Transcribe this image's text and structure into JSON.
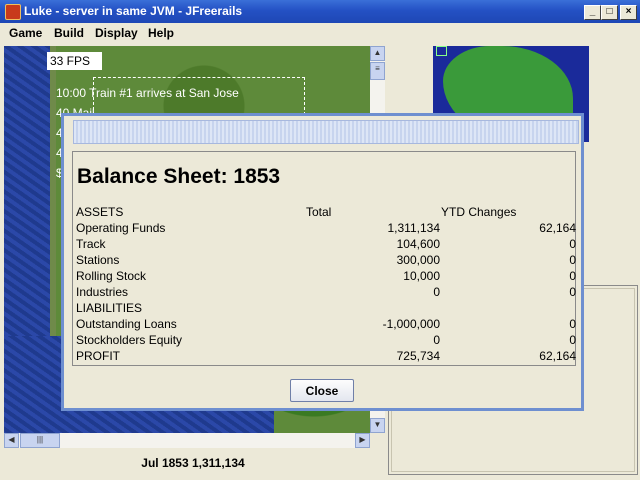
{
  "window": {
    "title": "Luke - server in same JVM - JFreerails"
  },
  "menu": {
    "items": [
      "Game",
      "Build",
      "Display",
      "Help"
    ]
  },
  "map": {
    "fps": "33 FPS",
    "message": "10:00  Train #1 arrives at San Jose",
    "side_fragments": [
      "40 Mail",
      "40",
      "4",
      "$"
    ]
  },
  "status": {
    "text": "Jul 1853  1,311,134"
  },
  "dialog": {
    "heading": "Balance Sheet: 1853",
    "columns": {
      "label": "ASSETS",
      "total": "Total",
      "ytd": "YTD Changes"
    },
    "rows": [
      {
        "label": "Operating Funds",
        "total": "1,311,134",
        "ytd": "62,164"
      },
      {
        "label": "Track",
        "total": "104,600",
        "ytd": "0"
      },
      {
        "label": "Stations",
        "total": "300,000",
        "ytd": "0"
      },
      {
        "label": "Rolling Stock",
        "total": "10,000",
        "ytd": "0"
      },
      {
        "label": "Industries",
        "total": "0",
        "ytd": "0"
      },
      {
        "label": "LIABILITIES",
        "total": "",
        "ytd": ""
      },
      {
        "label": "Outstanding Loans",
        "total": "-1,000,000",
        "ytd": "0"
      },
      {
        "label": "Stockholders Equity",
        "total": "0",
        "ytd": "0"
      },
      {
        "label": "PROFIT",
        "total": "725,734",
        "ytd": "62,164"
      }
    ],
    "close_label": "Close"
  }
}
